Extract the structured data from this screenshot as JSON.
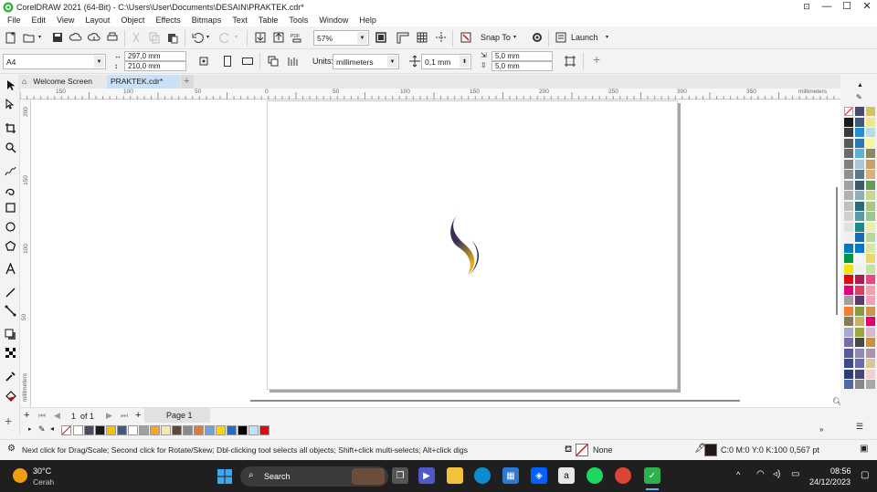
{
  "window": {
    "title": "CorelDRAW 2021 (64-Bit) - C:\\Users\\User\\Documents\\DESAIN\\PRAKTEK.cdr*",
    "controls": [
      "—",
      "☐",
      "✕"
    ]
  },
  "menu": [
    "File",
    "Edit",
    "View",
    "Layout",
    "Object",
    "Effects",
    "Bitmaps",
    "Text",
    "Table",
    "Tools",
    "Window",
    "Help"
  ],
  "standard_toolbar": {
    "zoom_value": "57%",
    "snap_to_label": "Snap To",
    "launch_label": "Launch"
  },
  "property_bar": {
    "page_size": "A4",
    "width": "297,0 mm",
    "height": "210,0 mm",
    "units_label": "Units:",
    "units_value": "millimeters",
    "nudge": "0,1 mm",
    "dup_x": "5,0 mm",
    "dup_y": "5,0 mm"
  },
  "tabs": [
    {
      "label": "Welcome Screen"
    },
    {
      "label": "PRAKTEK.cdr*"
    }
  ],
  "ruler": {
    "h_labels": [
      "150",
      "100",
      "50",
      "0",
      "50",
      "100",
      "150",
      "200",
      "250",
      "300",
      "350"
    ],
    "units": "millimeters",
    "v_labels": [
      "200",
      "150",
      "100",
      "50"
    ],
    "v_units": "millimeters"
  },
  "page_nav": {
    "current": "1",
    "of": "of",
    "total": "1",
    "page_tab": "Page 1"
  },
  "doc_palette": [
    "#ffffff",
    "#4a4a6a",
    "#1a1a1a",
    "#f2c500",
    "#3d5a80",
    "#ffffff",
    "#a0a0a0",
    "#f5a623",
    "#f9e9b0",
    "#5a4a3a",
    "#8a8a8a",
    "#e07b39",
    "#6fa3d8",
    "#ffd700",
    "#1e6fcc",
    "#000000",
    "#c4e0f5",
    "#e30613"
  ],
  "color_palette": [
    [
      "#ffffff",
      "#4a4a6a",
      "#d4c468"
    ],
    [
      "#1a1a1a",
      "#3d5a7a",
      "#f0e68c"
    ],
    [
      "#3a3a3a",
      "#1e90d6",
      "#b0e0e6"
    ],
    [
      "#5a5a5a",
      "#2a7ab8",
      "#f5f5a0"
    ],
    [
      "#6a6a6a",
      "#5ab4d6",
      "#8a8a5a"
    ],
    [
      "#808080",
      "#a8c8d8",
      "#c8a06a"
    ],
    [
      "#909090",
      "#5a7a8a",
      "#d8b078"
    ],
    [
      "#a0a0a0",
      "#3a5a6a",
      "#6a9a5a"
    ],
    [
      "#b0b0b0",
      "#8ab0b8",
      "#c8d890"
    ],
    [
      "#c0c0c0",
      "#2a6a7a",
      "#a8c880"
    ],
    [
      "#d0d0d0",
      "#5a9aa8",
      "#98c890"
    ],
    [
      "#e0e0e0",
      "#1a8a8a",
      "#e8f0b0"
    ],
    [
      "#f0f0f0",
      "#1a6ab8",
      "#b8d8a0"
    ],
    [
      "#007ac2",
      "#0078d4",
      "#d8e8a0"
    ],
    [
      "#00963f",
      "#f5f5f5",
      "#e8d870"
    ],
    [
      "#f2e600",
      "#f0f0f0",
      "#c8e0a0"
    ],
    [
      "#e30613",
      "#b01a50",
      "#e84a80"
    ],
    [
      "#e0007a",
      "#d84060",
      "#f0a0b0"
    ],
    [
      "#a0a0a0",
      "#5a3a6a",
      "#f0a0b8"
    ],
    [
      "#f08030",
      "#8a9a3a",
      "#c89850"
    ],
    [
      "#8a7a5a",
      "#c8b068",
      "#e8006a"
    ],
    [
      "#a8a8d0",
      "#9aa83a",
      "#d8b8d0"
    ],
    [
      "#7a6aa8",
      "#484848",
      "#c89040"
    ],
    [
      "#5a5aa0",
      "#8a8ab8",
      "#b090b0"
    ],
    [
      "#3a4a8a",
      "#6a6ab0",
      "#d8c898"
    ],
    [
      "#2a3a7a",
      "#484878",
      "#f0d0d0"
    ],
    [
      "#4a6aa0",
      "#888888",
      "#a8a8a8"
    ]
  ],
  "status": {
    "hint": "Next click for Drag/Scale; Second click for Rotate/Skew; Dbl-clicking tool selects all objects; Shift+click multi-selects; Alt+click digs",
    "fill_label": "None",
    "outline_label": "C:0 M:0 Y:0 K:100  0,567 pt"
  },
  "taskbar": {
    "weather_temp": "30°C",
    "weather_desc": "Cerah",
    "search_label": "Search",
    "time": "08:56",
    "date": "24/12/2023"
  },
  "colors": {
    "shape_dark": "#3a2f58",
    "shape_gold": "#e2ad1a"
  }
}
